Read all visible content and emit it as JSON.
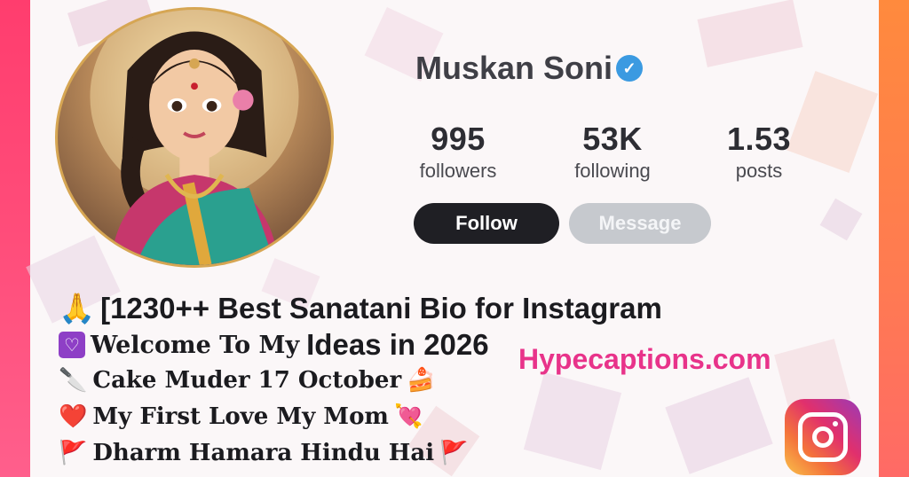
{
  "profile": {
    "name": "Muskan Soni",
    "verified_symbol": "✓"
  },
  "stats": {
    "followers": {
      "value": "995",
      "label": "followers"
    },
    "following": {
      "value": "53K",
      "label": "following"
    },
    "posts": {
      "value": "1.53",
      "label": "posts"
    }
  },
  "actions": {
    "follow_label": "Follow",
    "message_label": "Message"
  },
  "bio": {
    "line1": {
      "emoji": "🙏",
      "text": "[1230++ Best Sanatani Bio for Instagram"
    },
    "line2": {
      "emoji": "♡",
      "text": "Welcome To My",
      "rest": "Ideas in 2026"
    },
    "line3": {
      "emoji": "🔪",
      "text": "Cake Muder 17 October",
      "end_emoji": "🍰"
    },
    "line4": {
      "emoji": "❤️",
      "text": "My First Love My Mom",
      "end_emoji": "💘"
    },
    "line5": {
      "emoji": "🚩",
      "text": "Dharm Hamara Hindu Hai",
      "end_emoji": "🚩"
    }
  },
  "brand": {
    "text": "Hypecaptions.com",
    "color": "#e8338a"
  },
  "icons": {
    "verified": "verified-badge-icon",
    "instagram": "instagram-logo-icon",
    "avatar": "avatar-illustration"
  },
  "colors": {
    "left_edge": "#ff4d7a",
    "right_edge": "#ff7a52",
    "follow_bg": "#1f1f24",
    "message_bg": "#c6c9ce",
    "verified": "#3b9ae1"
  }
}
